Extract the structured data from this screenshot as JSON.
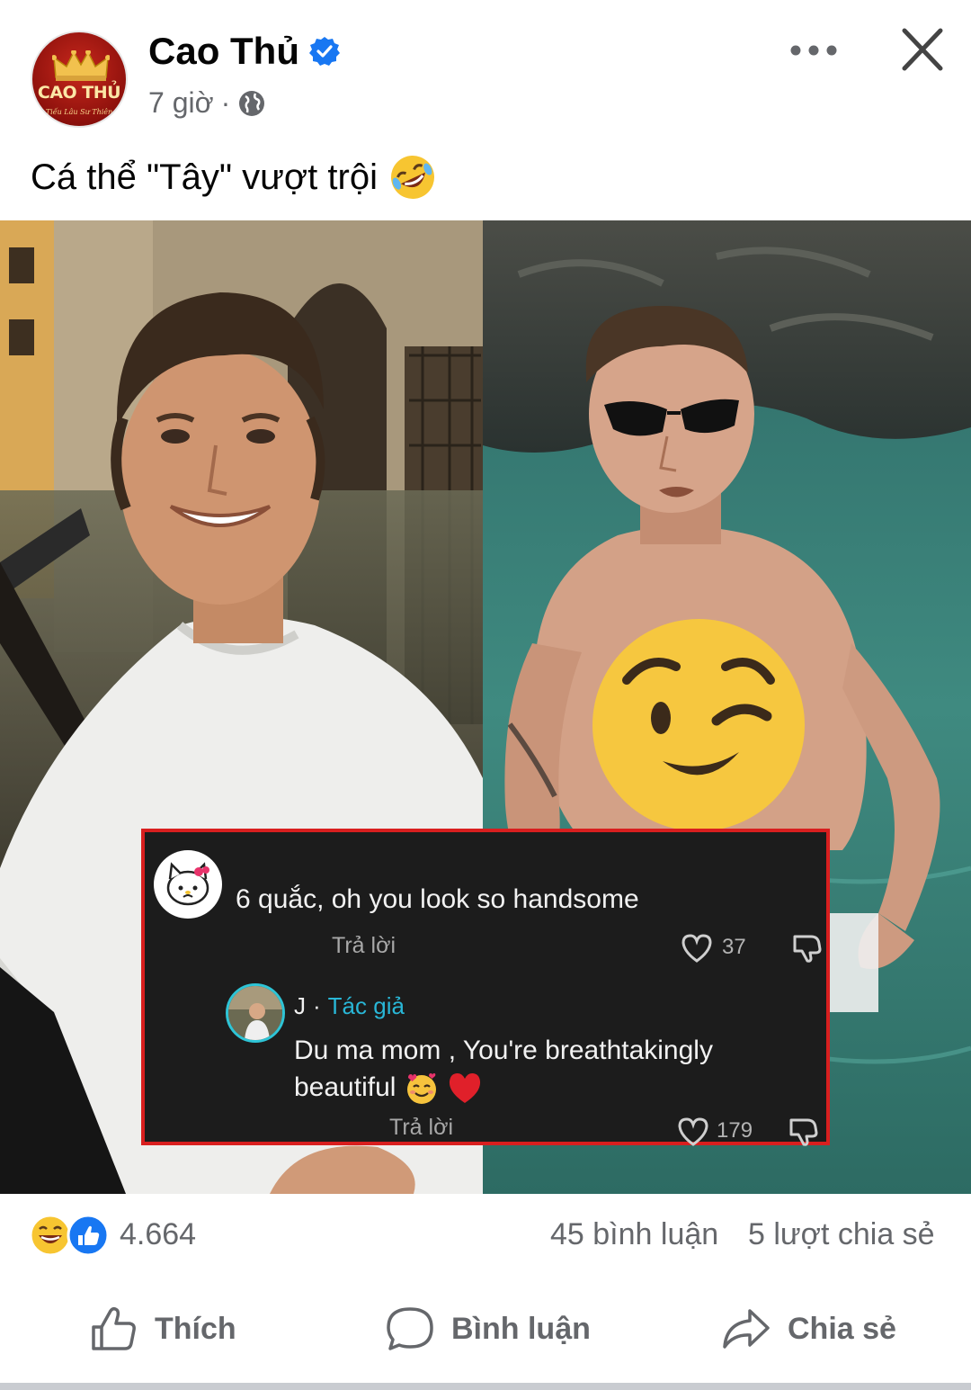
{
  "post": {
    "page_name": "Cao Thủ",
    "avatar_text": "CAO THỦ",
    "avatar_subtext": "Tiếu Lâu Sư Thiên",
    "time": "7 giờ",
    "separator": "·",
    "caption": "Cá thể \"Tây\" vượt trội"
  },
  "icons": {
    "verified": "verified-badge-icon",
    "globe": "globe-icon",
    "more": "more-dots-icon",
    "close": "close-icon",
    "caption_emoji": "rolling-laugh-emoji",
    "censor_emoji": "wink-emoji"
  },
  "comment_overlay": {
    "comment1": {
      "text": "6 quắc, oh you look so handsome",
      "reply_label": "Trả lời",
      "likes": "37"
    },
    "comment2": {
      "author": "J",
      "separator": "·",
      "author_badge": "Tác giả",
      "text": "Du ma mom , You're breathtakingly beautiful",
      "reply_label": "Trả lời",
      "likes": "179"
    }
  },
  "summary": {
    "reactions_count": "4.664",
    "comments": "45 bình luận",
    "shares": "5 lượt chia sẻ"
  },
  "actions": {
    "like": "Thích",
    "comment": "Bình luận",
    "share": "Chia sẻ"
  },
  "colors": {
    "border_red": "#d81f1f",
    "verified_blue": "#1877f2",
    "muted_text": "#65676b",
    "author_teal": "#29b6d6"
  }
}
